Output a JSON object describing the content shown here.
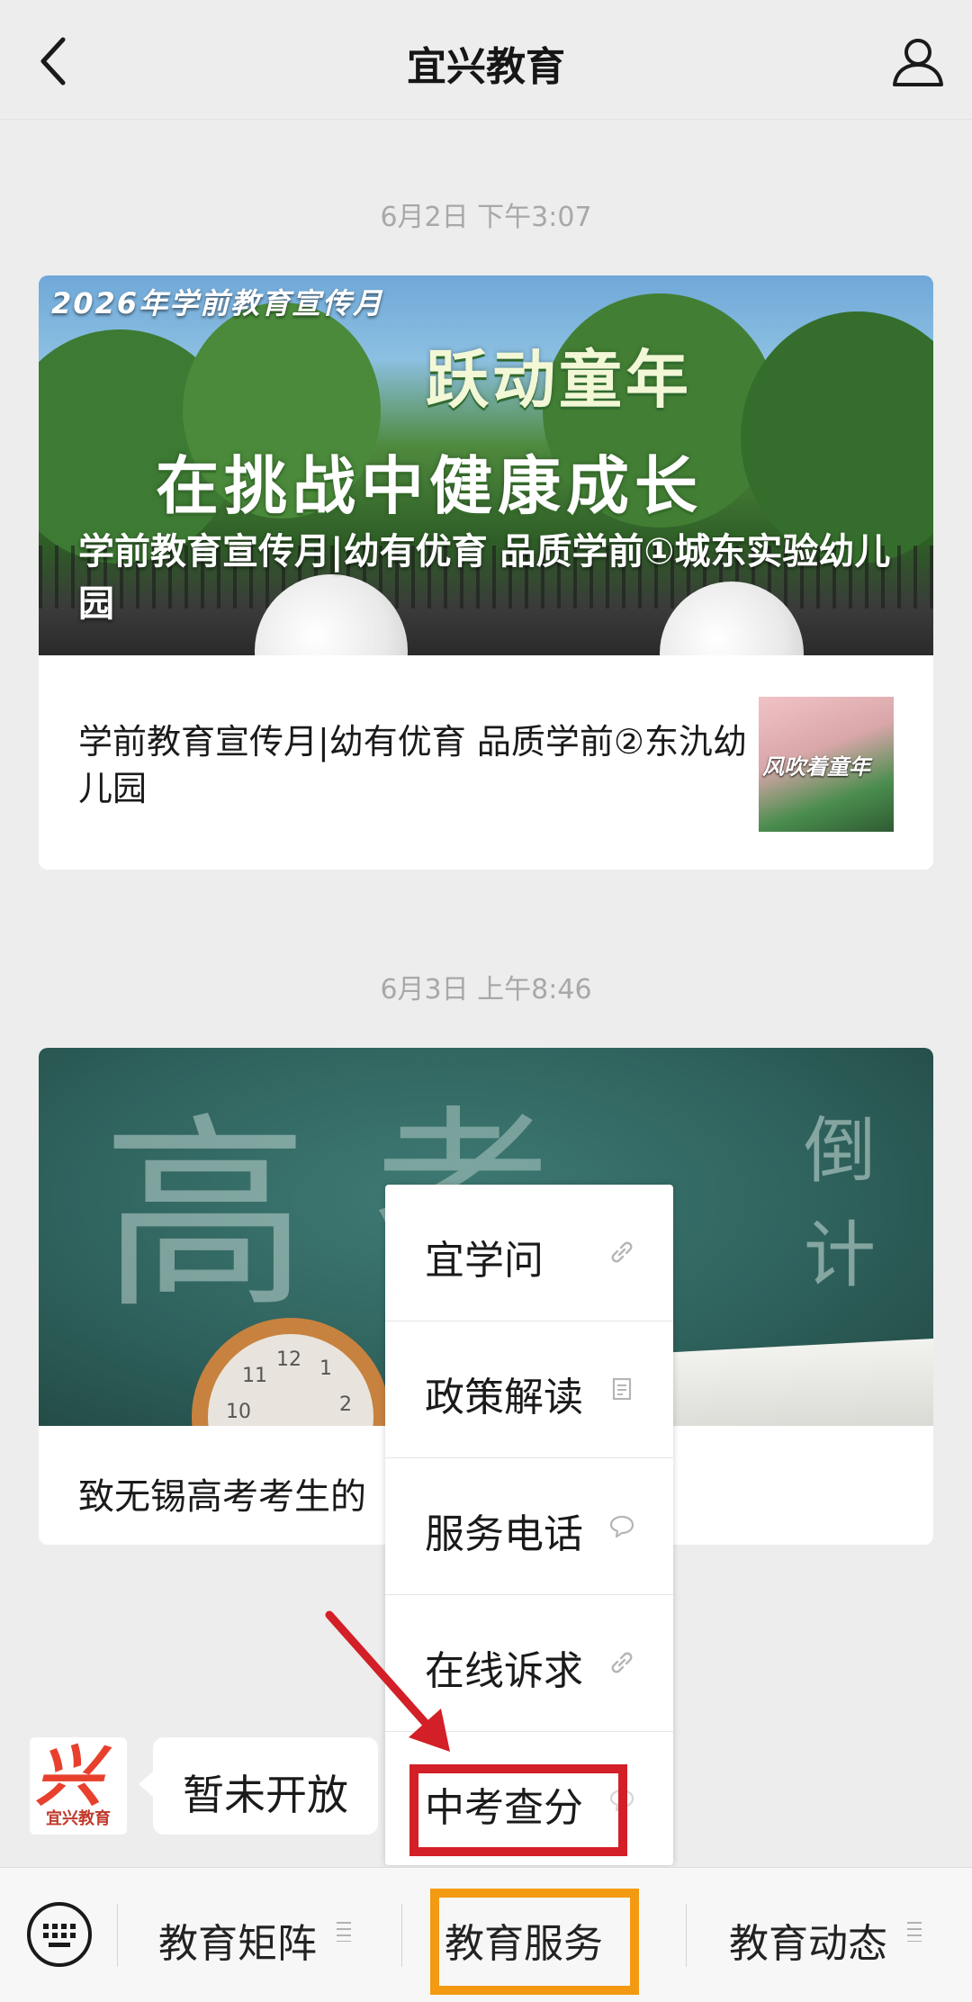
{
  "header": {
    "title": "宜兴教育"
  },
  "timestamps": [
    "6月2日 下午3:07",
    "6月3日 上午8:46"
  ],
  "article1": {
    "banner_caption": "2026年学前教育宣传月",
    "banner_line1": "跃动童年",
    "banner_line2": "在挑战中健康成长",
    "headline": "学前教育宣传月|幼有优育 品质学前①城东实验幼儿园",
    "sub_title": "学前教育宣传月|幼有优育 品质学前②东氿幼儿园",
    "thumb_text": "风吹着童年"
  },
  "article2": {
    "chalk_text_1": "高",
    "chalk_text_2": "考",
    "chalk_text_3": "倒计",
    "headline": "致无锡高考考生的",
    "clock_numbers": [
      "11",
      "12",
      "1",
      "10",
      "2"
    ]
  },
  "chat": {
    "avatar_text": "宜兴教育",
    "avatar_logo": "兴",
    "message": "暂未开放"
  },
  "popup_menu": [
    {
      "label": "宜学问",
      "icon": "link-icon"
    },
    {
      "label": "政策解读",
      "icon": "document-icon"
    },
    {
      "label": "服务电话",
      "icon": "chat-bubble-icon"
    },
    {
      "label": "在线诉求",
      "icon": "link-icon"
    },
    {
      "label": "中考查分",
      "icon": "chat-bubble-icon"
    }
  ],
  "bottom_menu": {
    "tabs": [
      "教育矩阵",
      "教育服务",
      "教育动态"
    ]
  },
  "colors": {
    "background": "#ededed",
    "annotation_red": "#d31f27",
    "annotation_orange": "#f39a12"
  }
}
